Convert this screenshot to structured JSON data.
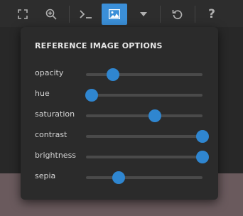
{
  "toolbar": {
    "buttons": [
      {
        "icon": "fullscreen-icon"
      },
      {
        "icon": "zoom-in-icon"
      },
      {
        "icon": "terminal-icon"
      },
      {
        "icon": "image-icon",
        "active": true
      },
      {
        "icon": "dropdown-caret-icon"
      },
      {
        "icon": "undo-icon"
      },
      {
        "icon": "help-icon",
        "glyph": "?"
      }
    ],
    "accent": "#3b8fd8"
  },
  "panel": {
    "title": "REFERENCE IMAGE OPTIONS",
    "sliders": [
      {
        "label": "opacity",
        "value": 0.23
      },
      {
        "label": "hue",
        "value": 0.05
      },
      {
        "label": "saturation",
        "value": 0.59
      },
      {
        "label": "contrast",
        "value": 1.0
      },
      {
        "label": "brightness",
        "value": 1.0
      },
      {
        "label": "sepia",
        "value": 0.28
      }
    ],
    "slider_color": "#2f86d0"
  }
}
